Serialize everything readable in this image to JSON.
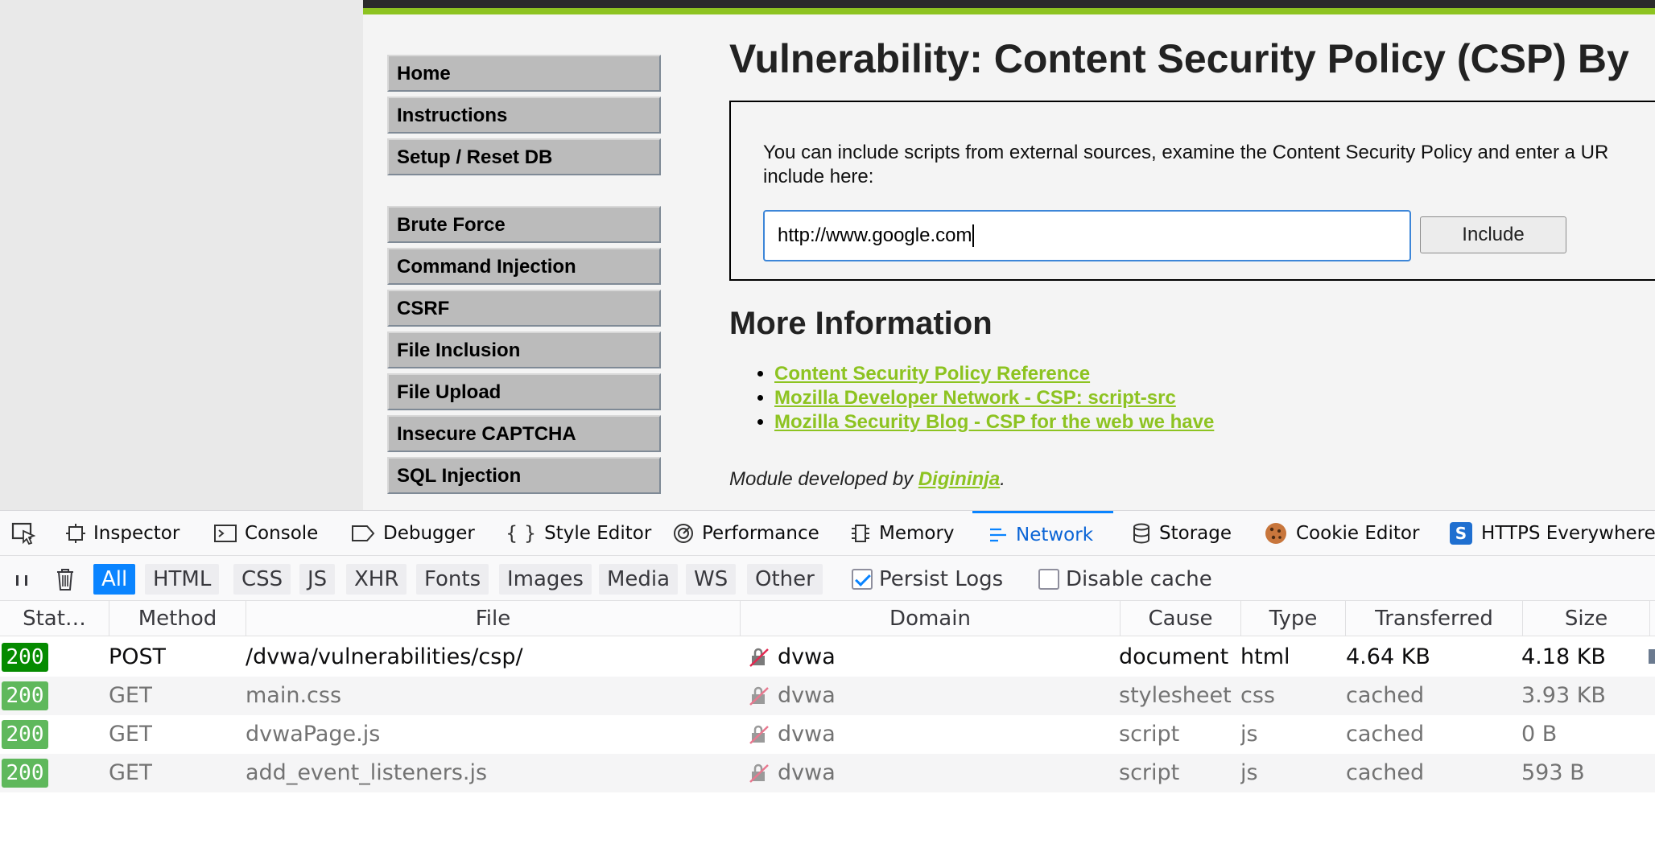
{
  "page": {
    "title": "Vulnerability: Content Security Policy (CSP) By",
    "menu": {
      "group1": [
        "Home",
        "Instructions",
        "Setup / Reset DB"
      ],
      "group2": [
        "Brute Force",
        "Command Injection",
        "CSRF",
        "File Inclusion",
        "File Upload",
        "Insecure CAPTCHA",
        "SQL Injection"
      ]
    },
    "vuln": {
      "description": "You can include scripts from external sources, examine the Content Security Policy and enter a UR include here:",
      "input_value": "http://www.google.com",
      "button_label": "Include"
    },
    "more_info": {
      "title": "More Information",
      "links": [
        "Content Security Policy Reference",
        "Mozilla Developer Network - CSP: script-src",
        "Mozilla Security Blog - CSP for the web we have"
      ]
    },
    "credit": {
      "prefix": "Module developed by ",
      "author": "Digininja",
      "suffix": "."
    },
    "colors": {
      "accent": "#8dc321",
      "header": "#2b2b2b"
    }
  },
  "devtools": {
    "tabs": [
      {
        "label": "Inspector",
        "icon": "inspector-icon"
      },
      {
        "label": "Console",
        "icon": "console-icon"
      },
      {
        "label": "Debugger",
        "icon": "debugger-icon"
      },
      {
        "label": "Style Editor",
        "icon": "braces-icon"
      },
      {
        "label": "Performance",
        "icon": "performance-icon"
      },
      {
        "label": "Memory",
        "icon": "memory-icon"
      },
      {
        "label": "Network",
        "icon": "network-icon",
        "selected": true
      },
      {
        "label": "Storage",
        "icon": "storage-icon"
      },
      {
        "label": "Cookie Editor",
        "icon": "cookie-icon"
      },
      {
        "label": "HTTPS Everywhere",
        "icon": "https-everywhere-icon"
      }
    ],
    "filters": [
      "All",
      "HTML",
      "CSS",
      "JS",
      "XHR",
      "Fonts",
      "Images",
      "Media",
      "WS",
      "Other"
    ],
    "selected_filter": "All",
    "persist_logs": {
      "label": "Persist Logs",
      "checked": true
    },
    "disable_cache": {
      "label": "Disable cache",
      "checked": false
    },
    "columns": [
      "Stat…",
      "Method",
      "File",
      "Domain",
      "Cause",
      "Type",
      "Transferred",
      "Size"
    ],
    "rows": [
      {
        "status": "200",
        "method": "POST",
        "file": "/dvwa/vulnerabilities/csp/",
        "domain": "dvwa",
        "cause": "document",
        "type": "html",
        "transferred": "4.64 KB",
        "size": "4.18 KB",
        "cached": false
      },
      {
        "status": "200",
        "method": "GET",
        "file": "main.css",
        "domain": "dvwa",
        "cause": "stylesheet",
        "type": "css",
        "transferred": "cached",
        "size": "3.93 KB",
        "cached": true
      },
      {
        "status": "200",
        "method": "GET",
        "file": "dvwaPage.js",
        "domain": "dvwa",
        "cause": "script",
        "type": "js",
        "transferred": "cached",
        "size": "0 B",
        "cached": true
      },
      {
        "status": "200",
        "method": "GET",
        "file": "add_event_listeners.js",
        "domain": "dvwa",
        "cause": "script",
        "type": "js",
        "transferred": "cached",
        "size": "593 B",
        "cached": true
      }
    ]
  }
}
